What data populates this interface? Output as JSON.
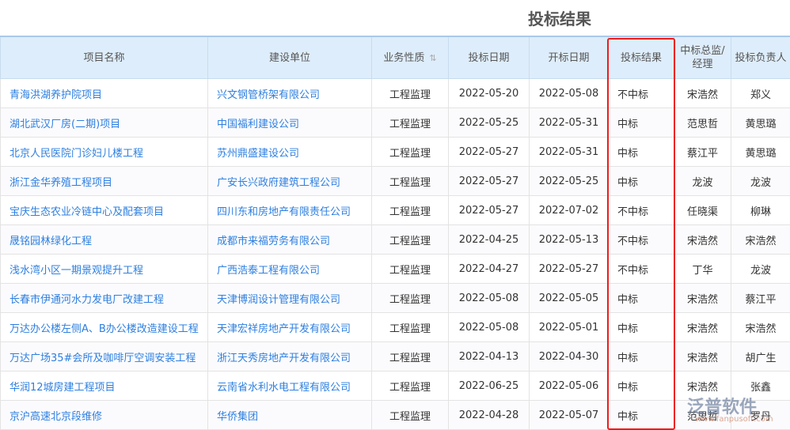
{
  "title": "投标结果",
  "headers": [
    "项目名称",
    "建设单位",
    "业务性质",
    "投标日期",
    "开标日期",
    "投标结果",
    "中标总监/经理",
    "投标负责人"
  ],
  "rows": [
    [
      "青海洪湖养护院项目",
      "兴文钢管桥架有限公司",
      "工程监理",
      "2022-05-20",
      "2022-05-08",
      "不中标",
      "宋浩然",
      "郑义"
    ],
    [
      "湖北武汉厂房(二期)项目",
      "中国福利建设公司",
      "工程监理",
      "2022-05-25",
      "2022-05-31",
      "中标",
      "范思哲",
      "黄思璐"
    ],
    [
      "北京人民医院门诊妇儿楼工程",
      "苏州鼎盛建设公司",
      "工程监理",
      "2022-05-27",
      "2022-05-31",
      "中标",
      "蔡江平",
      "黄思璐"
    ],
    [
      "浙江金华养殖工程项目",
      "广安长兴政府建筑工程公司",
      "工程监理",
      "2022-05-27",
      "2022-05-25",
      "中标",
      "龙波",
      "龙波"
    ],
    [
      "宝庆生态农业冷链中心及配套项目",
      "四川东和房地产有限责任公司",
      "工程监理",
      "2022-05-27",
      "2022-07-02",
      "不中标",
      "任晓渠",
      "柳琳"
    ],
    [
      "晟铭园林绿化工程",
      "成都市来福劳务有限公司",
      "工程监理",
      "2022-04-25",
      "2022-05-13",
      "不中标",
      "宋浩然",
      "宋浩然"
    ],
    [
      "浅水湾小区一期景观提升工程",
      "广西浩泰工程有限公司",
      "工程监理",
      "2022-04-27",
      "2022-05-27",
      "不中标",
      "丁华",
      "龙波"
    ],
    [
      "长春市伊通河水力发电厂改建工程",
      "天津博润设计管理有限公司",
      "工程监理",
      "2022-05-08",
      "2022-05-05",
      "中标",
      "宋浩然",
      "蔡江平"
    ],
    [
      "万达办公楼左侧A、B办公楼改造建设工程",
      "天津宏祥房地产开发有限公司",
      "工程监理",
      "2022-05-08",
      "2022-05-01",
      "中标",
      "宋浩然",
      "宋浩然"
    ],
    [
      "万达广场35#会所及咖啡厅空调安装工程",
      "浙江天秀房地产开发有限公司",
      "工程监理",
      "2022-04-13",
      "2022-04-30",
      "中标",
      "宋浩然",
      "胡广生"
    ],
    [
      "华润12城房建工程项目",
      "云南省水利水电工程有限公司",
      "工程监理",
      "2022-06-25",
      "2022-05-06",
      "中标",
      "宋浩然",
      "张鑫"
    ],
    [
      "京沪高速北京段维修",
      "华侨集团",
      "工程监理",
      "2022-04-28",
      "2022-05-07",
      "中标",
      "范思哲",
      "罗丹"
    ]
  ],
  "watermark": {
    "brand": "泛普软件",
    "url": "www.fanpusoft.com"
  }
}
